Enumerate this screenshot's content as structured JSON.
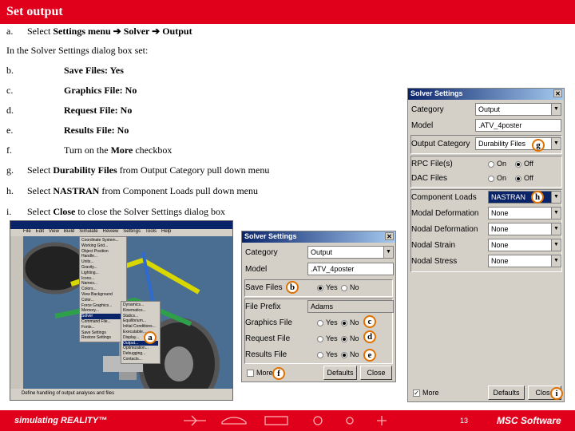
{
  "title": "Set output",
  "steps": [
    {
      "label": "a.",
      "parts": [
        {
          "t": "Select "
        },
        {
          "t": "Settings menu ➔ Solver ➔ Output",
          "b": true
        }
      ]
    },
    {
      "label": "",
      "parts": [
        {
          "t": "In the Solver Settings dialog box set:"
        }
      ]
    },
    {
      "label": "b.",
      "parts": [
        {
          "t": "Save Files: Yes",
          "b": true
        }
      ]
    },
    {
      "label": "c.",
      "parts": [
        {
          "t": "Graphics File: No",
          "b": true
        }
      ]
    },
    {
      "label": "d.",
      "parts": [
        {
          "t": "Request File: No",
          "b": true
        }
      ]
    },
    {
      "label": "e.",
      "parts": [
        {
          "t": "Results File: No",
          "b": true
        }
      ]
    },
    {
      "label": "f.",
      "parts": [
        {
          "t": "Turn on the "
        },
        {
          "t": "More",
          "b": true
        },
        {
          "t": " checkbox"
        }
      ]
    },
    {
      "label": "g.",
      "parts": [
        {
          "t": "Select "
        },
        {
          "t": "Durability Files",
          "b": true
        },
        {
          "t": " from Output Category pull down menu"
        }
      ]
    },
    {
      "label": "h.",
      "parts": [
        {
          "t": "Select "
        },
        {
          "t": "NASTRAN",
          "b": true
        },
        {
          "t": " from Component Loads pull down menu"
        }
      ]
    },
    {
      "label": "i.",
      "parts": [
        {
          "t": "Select "
        },
        {
          "t": "Close",
          "b": true
        },
        {
          "t": " to close the Solver Settings dialog box"
        }
      ]
    }
  ],
  "small_dialog": {
    "title": "Solver Settings",
    "category_label": "Category",
    "category_value": "Output",
    "model_label": "Model",
    "model_value": ".ATV_4poster",
    "save_files_label": "Save Files",
    "file_prefix_label": "File Prefix",
    "file_prefix_value": "Adams",
    "graphics_label": "Graphics File",
    "request_label": "Request File",
    "results_label": "Results File",
    "yes": "Yes",
    "no": "No",
    "more_label": "More",
    "defaults_button": "Defaults",
    "close_button": "Close"
  },
  "large_dialog": {
    "title": "Solver Settings",
    "category_label": "Category",
    "category_value": "Output",
    "model_label": "Model",
    "model_value": ".ATV_4poster",
    "output_category_label": "Output Category",
    "output_category_value": "Durability Files",
    "rpc_label": "RPC File(s)",
    "dac_label": "DAC Files",
    "on": "On",
    "off": "Off",
    "component_loads_label": "Component Loads",
    "component_loads_value": "NASTRAN",
    "modal_def_label": "Modal Deformation",
    "nodal_def_label": "Nodal Deformation",
    "nodal_strain_label": "Nodal Strain",
    "nodal_stress_label": "Nodal Stress",
    "none": "None",
    "more_label": "More",
    "defaults_button": "Defaults",
    "close_button": "Close"
  },
  "app_screenshot": {
    "menu": [
      "File",
      "Edit",
      "View",
      "Build",
      "Simulate",
      "Review",
      "Settings",
      "Tools",
      "Help"
    ],
    "settings_menu": [
      "Coordinate System...",
      "Working Grid...",
      "Object Position Handle...",
      "Units...",
      "Gravity...",
      "Lighting...",
      "Icons...",
      "Names...",
      "Colors...",
      "View Background Color...",
      "Force Graphics...",
      "Memory...",
      "Solver",
      "Command File...",
      "Fonts...",
      "Save Settings",
      "Restore Settings"
    ],
    "solver_submenu": [
      "Dynamics...",
      "Kinematics...",
      "Statics...",
      "Equilibrium...",
      "Initial Conditions...",
      "Executable...",
      "Display...",
      "Output...",
      "Optimization...",
      "Debugging...",
      "Contacts..."
    ],
    "status": "Define handling of output analyses and files"
  },
  "callouts": [
    "a",
    "b",
    "c",
    "d",
    "e",
    "f",
    "g",
    "h",
    "i"
  ],
  "footer": {
    "left": "simulating REALITY™",
    "page": "13",
    "right": "MSC Software"
  },
  "colors": {
    "accent": "#e0001c",
    "dialog_bg": "#d4d0c8",
    "titlebar": "#0a246a",
    "callout": "#e07000"
  }
}
